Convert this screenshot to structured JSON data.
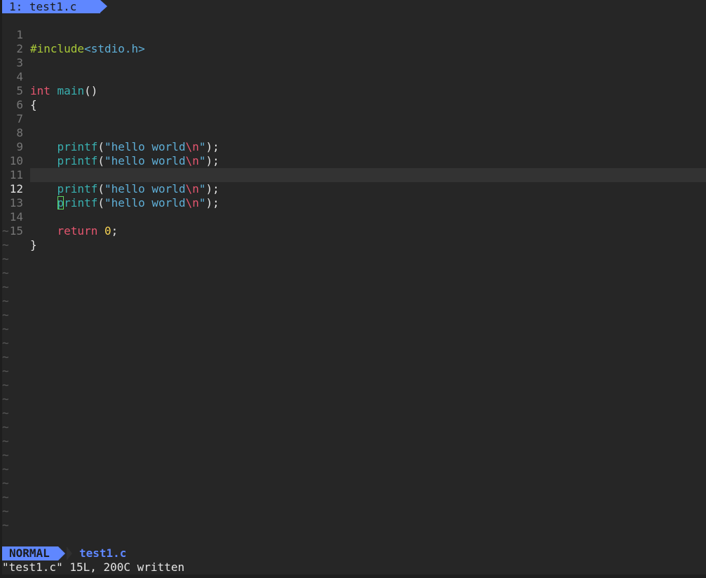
{
  "tabline": {
    "tab_label": "1: test1.c"
  },
  "editor": {
    "line_numbers": [
      "1",
      "2",
      "3",
      "4",
      "5",
      "6",
      "7",
      "8",
      "9",
      "10",
      "11",
      "12",
      "13",
      "14",
      "15"
    ],
    "include": {
      "directive": "#include",
      "header": "<stdio.h>"
    },
    "main_decl": {
      "type": "int",
      "name": "main",
      "parens": "()"
    },
    "open_brace": "{",
    "close_brace": "}",
    "printf_call": {
      "fn": "printf",
      "open": "(",
      "quote_open": "\"",
      "text": "hello world",
      "escape": "\\n",
      "quote_close": "\"",
      "close": ");"
    },
    "return_stmt": {
      "keyword": "return",
      "value": "0",
      "semicolon": ";"
    },
    "cursor_char": "p",
    "cursor_rest": "rintf",
    "tilde": "~"
  },
  "statusline": {
    "mode": "NORMAL",
    "filename": "test1.c"
  },
  "cmdline": {
    "message": "\"test1.c\" 15L, 200C written"
  },
  "colors": {
    "accent": "#5f87ff",
    "keyword": "#e5566f",
    "function": "#39b0b0",
    "string": "#5fafd7",
    "number": "#f7d354",
    "preprocessor": "#a8c838",
    "cursor": "#5fd75f"
  }
}
